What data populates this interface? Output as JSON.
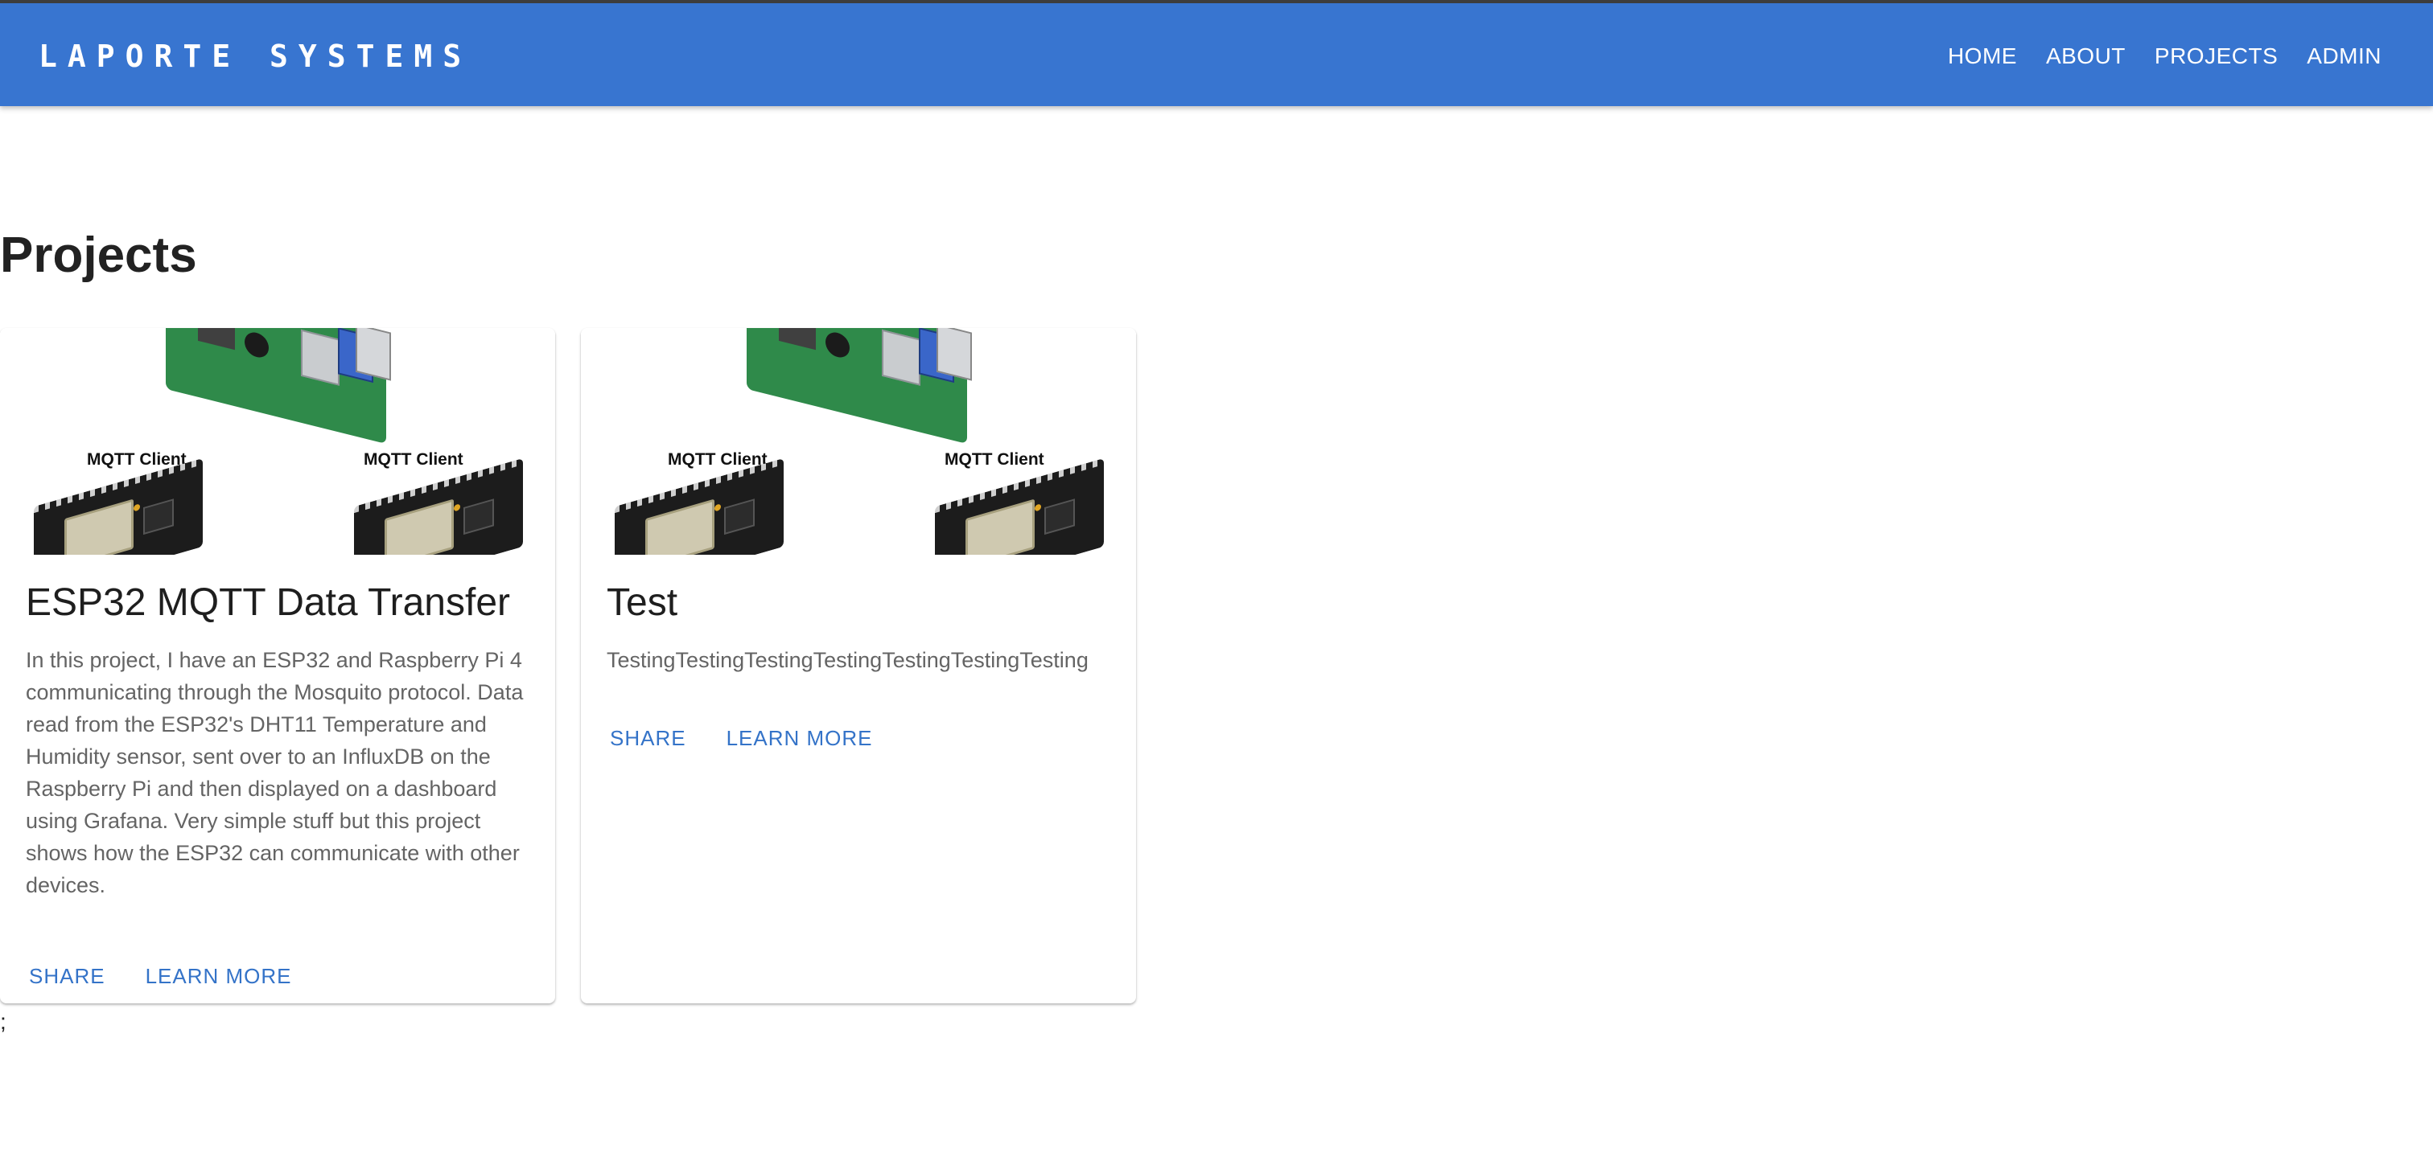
{
  "appbar": {
    "brand": "LAPORTE SYSTEMS",
    "brand_color": "#3875d0",
    "nav": [
      {
        "label": "HOME"
      },
      {
        "label": "ABOUT"
      },
      {
        "label": "PROJECTS"
      },
      {
        "label": "ADMIN"
      }
    ]
  },
  "main": {
    "title": "Projects",
    "cards": [
      {
        "image_label_left": "MQTT Client",
        "image_label_right": "MQTT Client",
        "title": "ESP32 MQTT Data Transfer",
        "description": "In this project, I have an ESP32 and Raspberry Pi 4 communicating through the Mosquito protocol. Data read from the ESP32's DHT11 Temperature and Humidity sensor, sent over to an InfluxDB on the Raspberry Pi and then displayed on a dashboard using Grafana. Very simple stuff but this project shows how the ESP32 can communicate with other devices.",
        "share_label": "SHARE",
        "learn_more_label": "LEARN MORE"
      },
      {
        "image_label_left": "MQTT Client",
        "image_label_right": "MQTT Client",
        "title": "Test",
        "description": "TestingTestingTestingTestingTestingTestingTesting",
        "share_label": "SHARE",
        "learn_more_label": "LEARN MORE"
      }
    ],
    "stray_text": ";"
  },
  "colors": {
    "accent": "#3875d0",
    "button_text": "#3473c8",
    "body_text": "#646464"
  }
}
